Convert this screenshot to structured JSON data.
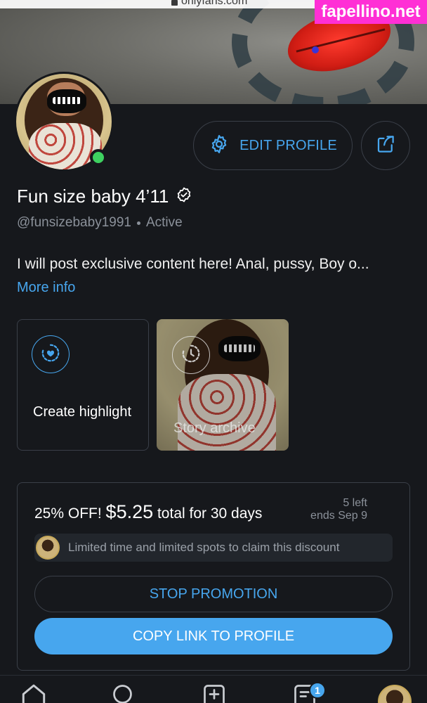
{
  "browser": {
    "url": "onlyfans.com"
  },
  "watermark": "fapellino.net",
  "profile": {
    "name": "Fun size baby 4’11",
    "handle": "@funsizebaby1991",
    "status": "Active",
    "online": true,
    "bio": "I will post exclusive content here! Anal, pussy, Boy o...",
    "more_info_label": "More info"
  },
  "actions": {
    "edit_profile_label": "EDIT PROFILE",
    "share_icon": "share-icon"
  },
  "highlights": [
    {
      "label": "Create highlight",
      "icon": "add-highlight-icon"
    },
    {
      "label": "Story archive",
      "icon": "archive-clock-icon"
    }
  ],
  "promotion": {
    "discount": "25% OFF!",
    "price": "$5.25",
    "period": "total for 30 days",
    "left": "5 left",
    "ends": "ends Sep 9",
    "note": "Limited time and limited spots to claim this discount",
    "stop_label": "STOP PROMOTION",
    "copy_label": "COPY LINK TO PROFILE"
  },
  "bottom_nav": {
    "items": [
      "home-icon",
      "search-icon",
      "add-post-icon",
      "messages-icon",
      "profile-avatar"
    ],
    "messages_badge": "1"
  },
  "colors": {
    "accent": "#47a6ee",
    "background": "#16181c",
    "online": "#3ed160",
    "border": "#3a3f48"
  }
}
